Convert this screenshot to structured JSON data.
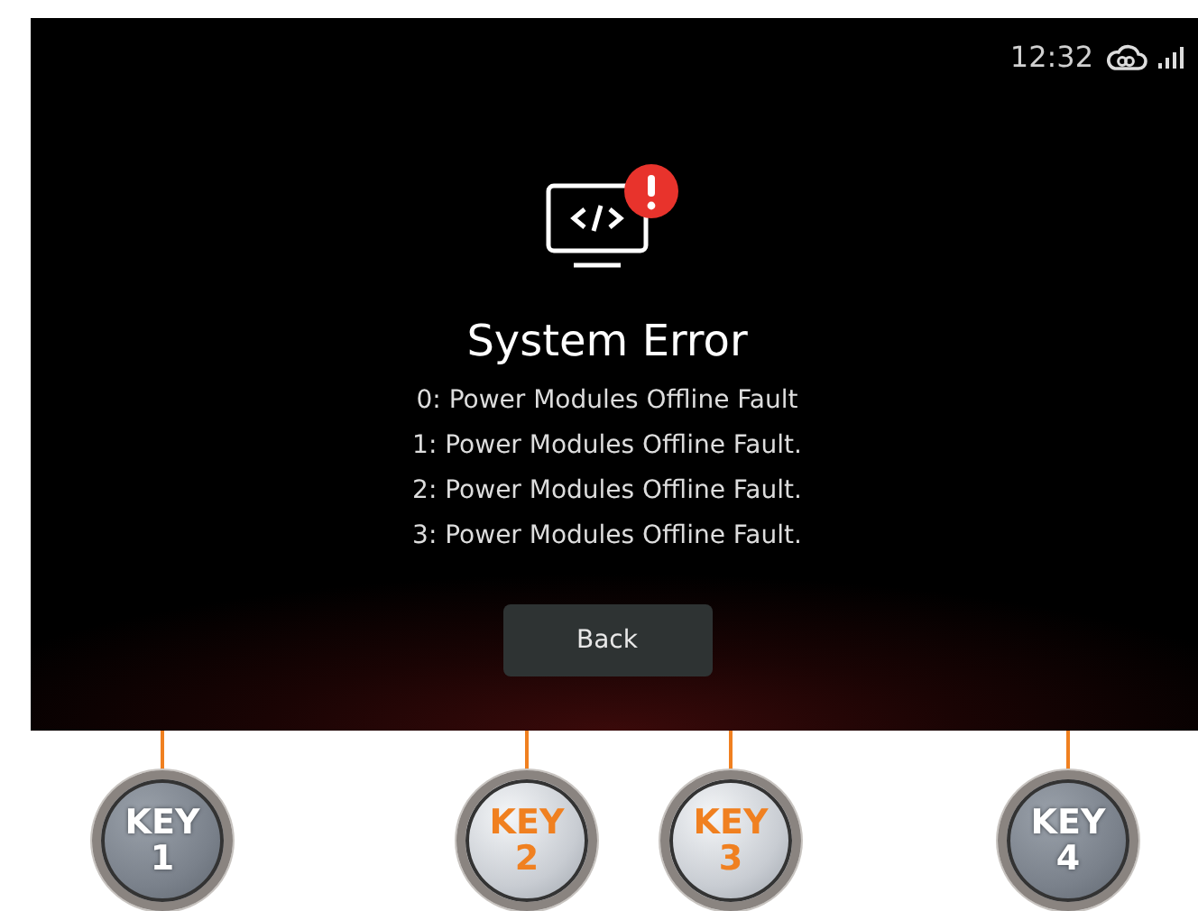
{
  "status_bar": {
    "time": "12:32"
  },
  "error": {
    "title": "System Error",
    "messages": [
      "0: Power Modules Offline Fault",
      "1: Power Modules Offline Fault.",
      "2: Power Modules Offline Fault.",
      "3: Power Modules Offline Fault."
    ]
  },
  "buttons": [
    {
      "label": "Back"
    }
  ],
  "keys": [
    {
      "label": "KEY",
      "number": "1",
      "active": false
    },
    {
      "label": "KEY",
      "number": "2",
      "active": true
    },
    {
      "label": "KEY",
      "number": "3",
      "active": true
    },
    {
      "label": "KEY",
      "number": "4",
      "active": false
    }
  ]
}
